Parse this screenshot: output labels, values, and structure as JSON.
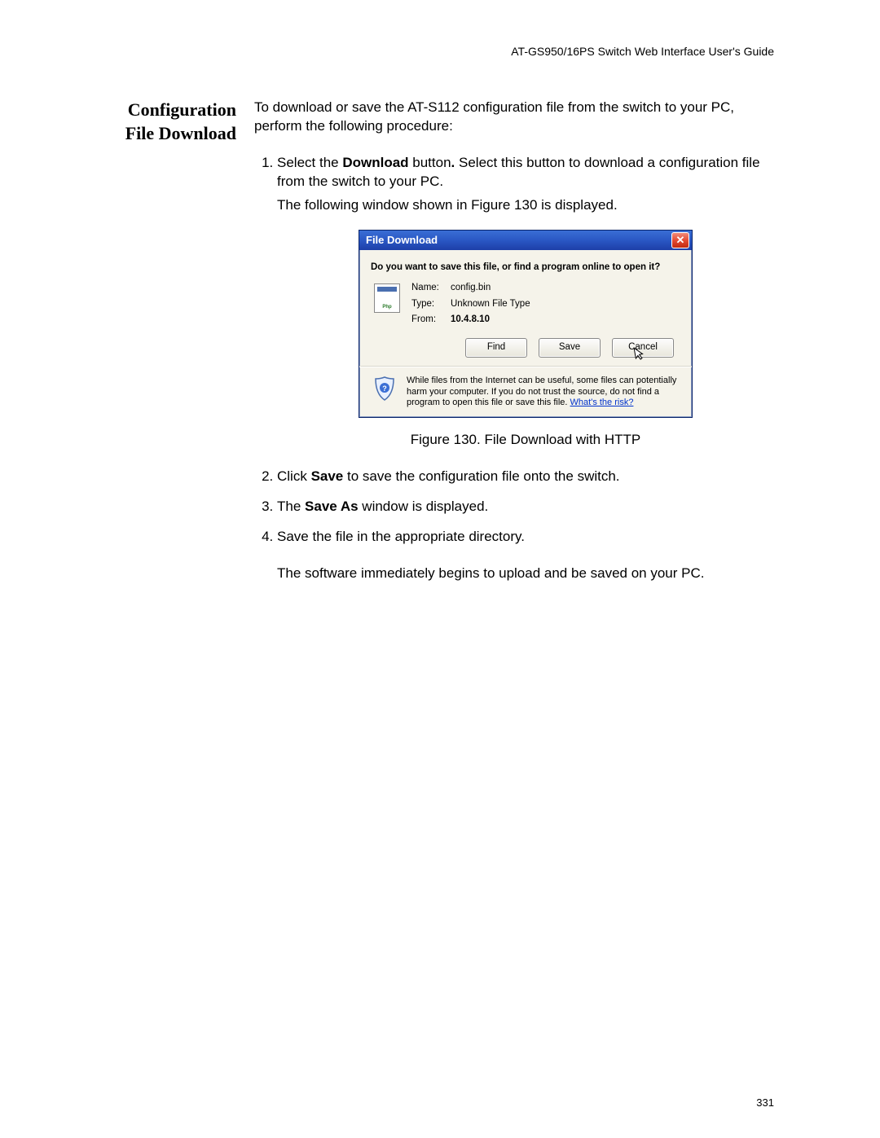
{
  "header": {
    "doc_title": "AT-GS950/16PS Switch Web Interface User's Guide"
  },
  "side_heading": "Configuration File Download",
  "intro": "To download or save the AT-S112 configuration file from the switch to your PC, perform the following procedure:",
  "steps": {
    "s1a": "Select the ",
    "s1b": "Download",
    "s1c": " button",
    "s1d": ".",
    "s1e": " Select this button to download a configuration file from the switch to your PC.",
    "s1f": "The following window shown in Figure 130 is displayed.",
    "s2a": "Click ",
    "s2b": "Save",
    "s2c": " to save the configuration file onto the switch.",
    "s3a": "The ",
    "s3b": "Save As",
    "s3c": " window is displayed.",
    "s4a": "Save the file in the appropriate directory.",
    "trailing": "The software immediately begins to upload and be saved on your PC."
  },
  "figure_caption": "Figure 130. File Download with HTTP",
  "dialog": {
    "title": "File Download",
    "question": "Do you want to save this file, or find a program online to open it?",
    "name_label": "Name:",
    "name_value": "config.bin",
    "type_label": "Type:",
    "type_value": "Unknown File Type",
    "from_label": "From:",
    "from_value": "10.4.8.10",
    "btn_find": "Find",
    "btn_save": "Save",
    "btn_cancel": "Cancel",
    "warning": "While files from the Internet can be useful, some files can potentially harm your computer. If you do not trust the source, do not find a program to open this file or save this file. ",
    "warning_link": "What's the risk?",
    "icon_label": "Php"
  },
  "page_number": "331"
}
